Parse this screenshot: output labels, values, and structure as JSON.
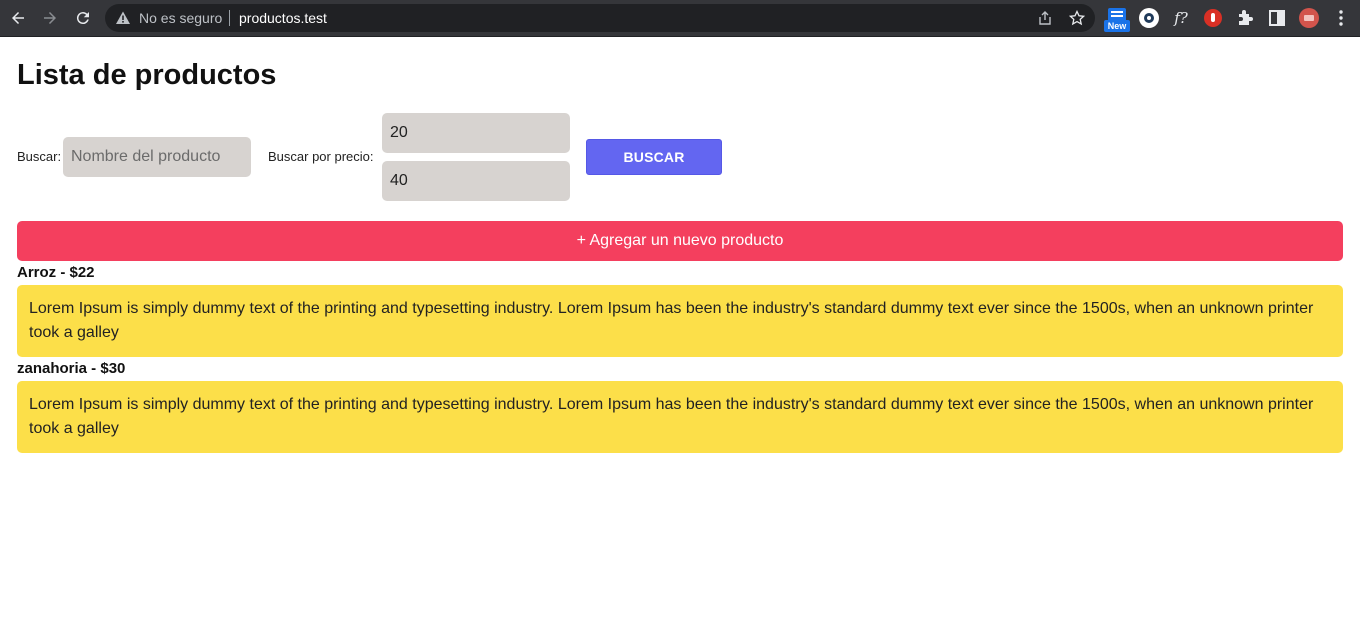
{
  "browser": {
    "security_label": "No es seguro",
    "url": "productos.test",
    "extension_badge": "New",
    "extension_fx": "f?"
  },
  "page": {
    "title": "Lista de productos"
  },
  "search": {
    "name_label": "Buscar:",
    "name_placeholder": "Nombre del producto",
    "price_label": "Buscar por precio:",
    "price_min": "20",
    "price_max": "40",
    "button_label": "BUSCAR"
  },
  "add_button": {
    "label": "+ Agregar un nuevo producto"
  },
  "products": [
    {
      "heading": "Arroz - $22",
      "description": "Lorem Ipsum is simply dummy text of the printing and typesetting industry. Lorem Ipsum has been the industry's standard dummy text ever since the 1500s, when an unknown printer took a galley"
    },
    {
      "heading": "zanahoria - $30",
      "description": "Lorem Ipsum is simply dummy text of the printing and typesetting industry. Lorem Ipsum has been the industry's standard dummy text ever since the 1500s, when an unknown printer took a galley"
    }
  ],
  "colors": {
    "add_button": "#f43f5e",
    "search_button": "#6366f1",
    "description_bg": "#fcdf49",
    "input_bg": "#d7d3d0"
  }
}
